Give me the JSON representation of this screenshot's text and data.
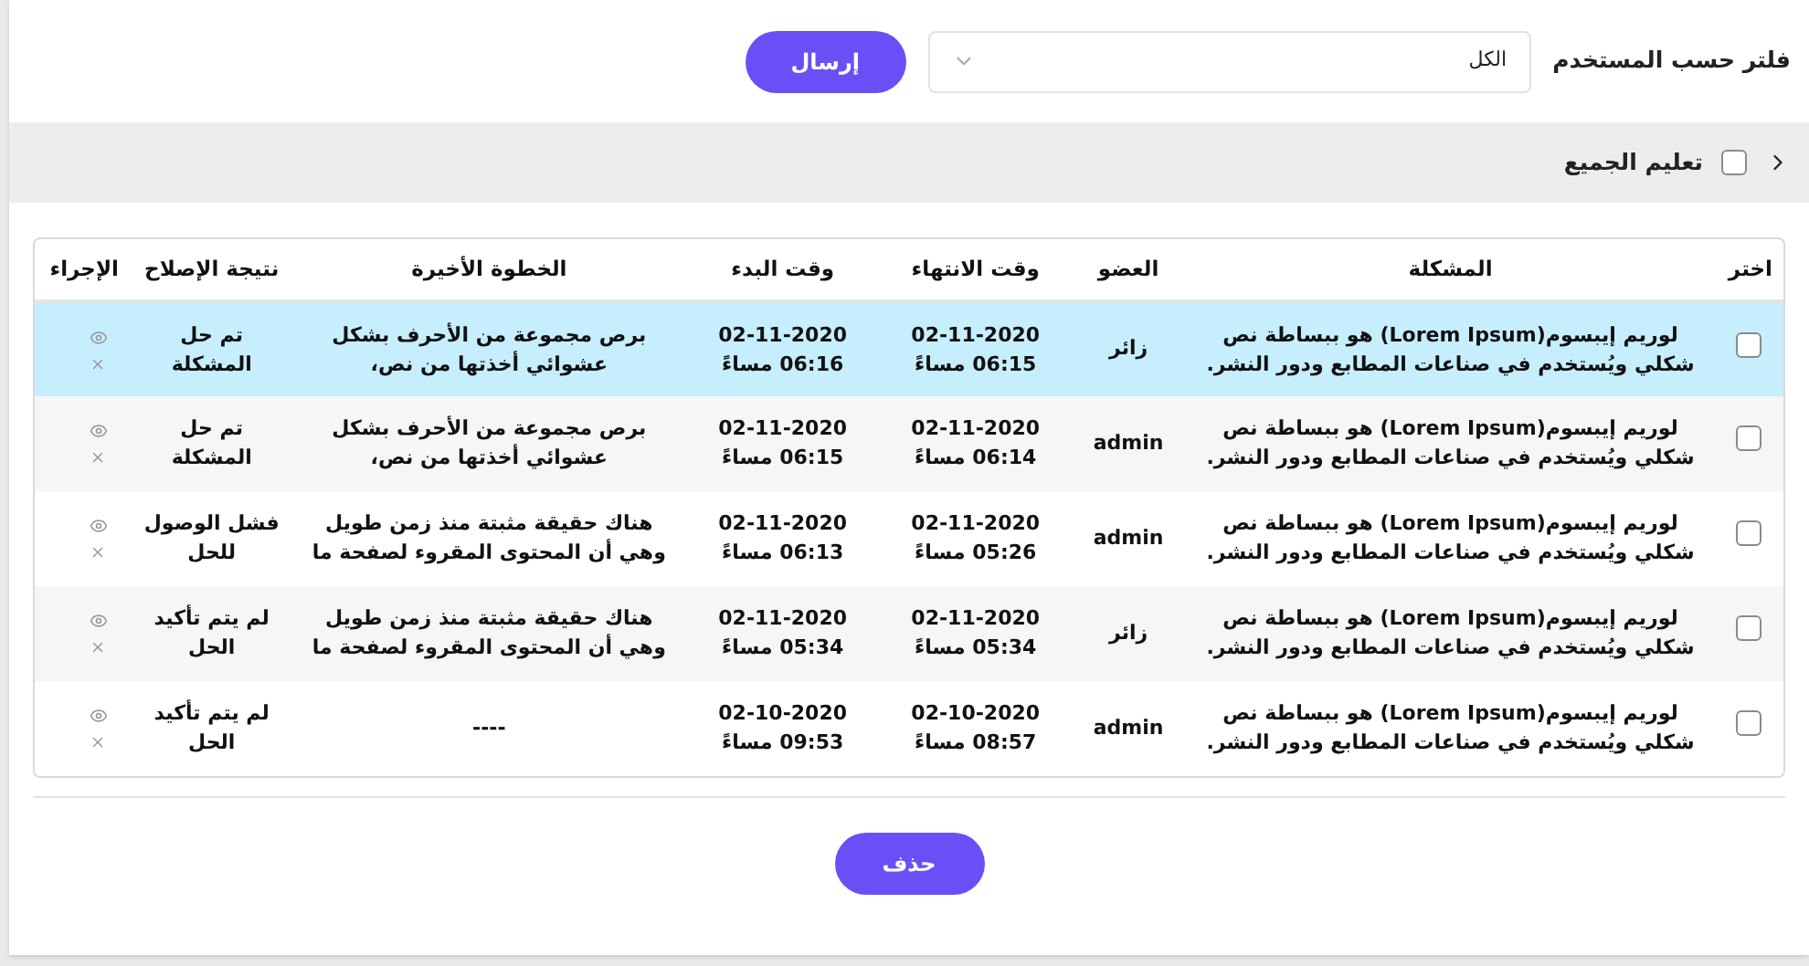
{
  "filter": {
    "label": "فلتر حسب المستخدم",
    "value": "الكل",
    "submit": "إرسال"
  },
  "bulk": {
    "label": "تعليم الجميع",
    "checked": false
  },
  "table": {
    "columns": [
      "اختر",
      "المشكلة",
      "العضو",
      "وقت الانتهاء",
      "وقت البدء",
      "الخطوة الأخيرة",
      "نتيجة الإصلاح",
      "الإجراء"
    ],
    "rows": [
      {
        "selected": true,
        "checked": false,
        "problem": "لوريم إيبسوم(Lorem Ipsum) هو ببساطة نص شكلي ويُستخدم في صناعات المطابع ودور النشر.",
        "member": "زائر",
        "end_date": "02-11-2020",
        "end_time": "06:15 مساءً",
        "start_date": "02-11-2020",
        "start_time": "06:16 مساءً",
        "last_step": "برص مجموعة من الأحرف بشكل عشوائي أخذتها من نص،",
        "result": "تم حل المشكلة"
      },
      {
        "selected": false,
        "checked": false,
        "problem": "لوريم إيبسوم(Lorem Ipsum) هو ببساطة نص شكلي ويُستخدم في صناعات المطابع ودور النشر.",
        "member": "admin",
        "end_date": "02-11-2020",
        "end_time": "06:14 مساءً",
        "start_date": "02-11-2020",
        "start_time": "06:15 مساءً",
        "last_step": "برص مجموعة من الأحرف بشكل عشوائي أخذتها من نص،",
        "result": "تم حل المشكلة"
      },
      {
        "selected": false,
        "checked": false,
        "problem": "لوريم إيبسوم(Lorem Ipsum) هو ببساطة نص شكلي ويُستخدم في صناعات المطابع ودور النشر.",
        "member": "admin",
        "end_date": "02-11-2020",
        "end_time": "05:26 مساءً",
        "start_date": "02-11-2020",
        "start_time": "06:13 مساءً",
        "last_step": "هناك حقيقة مثبتة منذ زمن طويل وهي أن المحتوى المقروء لصفحة ما",
        "result": "فشل الوصول للحل"
      },
      {
        "selected": false,
        "checked": false,
        "problem": "لوريم إيبسوم(Lorem Ipsum) هو ببساطة نص شكلي ويُستخدم في صناعات المطابع ودور النشر.",
        "member": "زائر",
        "end_date": "02-11-2020",
        "end_time": "05:34 مساءً",
        "start_date": "02-11-2020",
        "start_time": "05:34 مساءً",
        "last_step": "هناك حقيقة مثبتة منذ زمن طويل وهي أن المحتوى المقروء لصفحة ما",
        "result": "لم يتم تأكيد الحل"
      },
      {
        "selected": false,
        "checked": false,
        "problem": "لوريم إيبسوم(Lorem Ipsum) هو ببساطة نص شكلي ويُستخدم في صناعات المطابع ودور النشر.",
        "member": "admin",
        "end_date": "02-10-2020",
        "end_time": "08:57 مساءً",
        "start_date": "02-10-2020",
        "start_time": "09:53 مساءً",
        "last_step": "----",
        "result": "لم يتم تأكيد الحل"
      }
    ]
  },
  "delete_button": "حذف"
}
